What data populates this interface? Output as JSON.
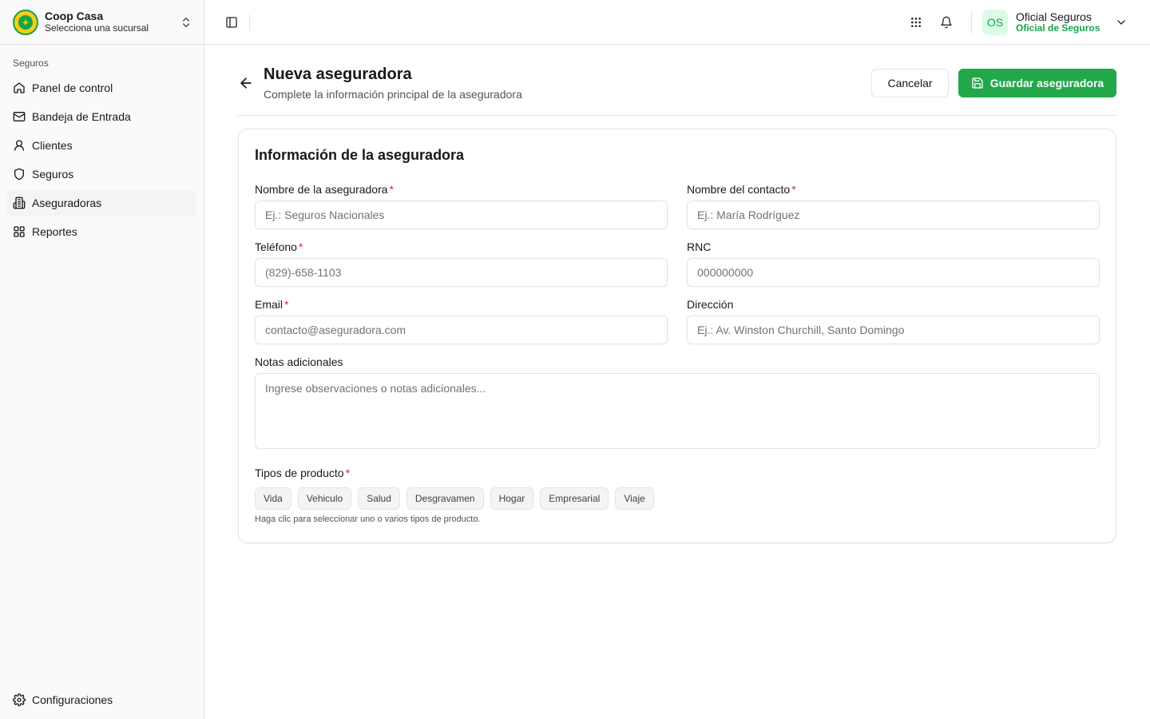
{
  "org": {
    "name": "Coop Casa",
    "subtitle": "Selecciona una sucursal"
  },
  "sidebar": {
    "group_label": "Seguros",
    "items": [
      {
        "label": "Panel de control",
        "icon": "home-icon"
      },
      {
        "label": "Bandeja de Entrada",
        "icon": "mail-icon"
      },
      {
        "label": "Clientes",
        "icon": "user-icon"
      },
      {
        "label": "Seguros",
        "icon": "shield-icon"
      },
      {
        "label": "Aseguradoras",
        "icon": "building-icon",
        "active": true
      },
      {
        "label": "Reportes",
        "icon": "grid-icon"
      }
    ],
    "footer_item": {
      "label": "Configuraciones",
      "icon": "gear-icon"
    }
  },
  "topbar": {
    "user_initials": "OS",
    "user_name": "Oficial Seguros",
    "user_role": "Oficial de Seguros"
  },
  "page": {
    "title": "Nueva aseguradora",
    "subtitle": "Complete la información principal de la aseguradora",
    "cancel_label": "Cancelar",
    "save_label": "Guardar aseguradora"
  },
  "form": {
    "section_title": "Información de la aseguradora",
    "required_mark": "*",
    "fields": {
      "nombre": {
        "label": "Nombre de la aseguradora",
        "placeholder": "Ej.: Seguros Nacionales",
        "required": true
      },
      "contacto": {
        "label": "Nombre del contacto",
        "placeholder": "Ej.: María Rodríguez",
        "required": true
      },
      "telefono": {
        "label": "Teléfono",
        "placeholder": "(829)-658-1103",
        "required": true
      },
      "rnc": {
        "label": "RNC",
        "placeholder": "000000000",
        "required": false
      },
      "email": {
        "label": "Email",
        "placeholder": "contacto@aseguradora.com",
        "required": true
      },
      "direccion": {
        "label": "Dirección",
        "placeholder": "Ej.: Av. Winston Churchill, Santo Domingo",
        "required": false
      },
      "notas": {
        "label": "Notas adicionales",
        "placeholder": "Ingrese observaciones o notas adicionales...",
        "required": false
      }
    },
    "product_types": {
      "label": "Tipos de producto",
      "options": [
        "Vida",
        "Vehiculo",
        "Salud",
        "Desgravamen",
        "Hogar",
        "Empresarial",
        "Viaje"
      ],
      "hint": "Haga clic para seleccionar uno o varios tipos de producto."
    }
  },
  "colors": {
    "brand_green": "#22a84a",
    "required_red": "#dc2626",
    "border": "#e4e4e7",
    "sidebar_bg": "#fafafa"
  }
}
